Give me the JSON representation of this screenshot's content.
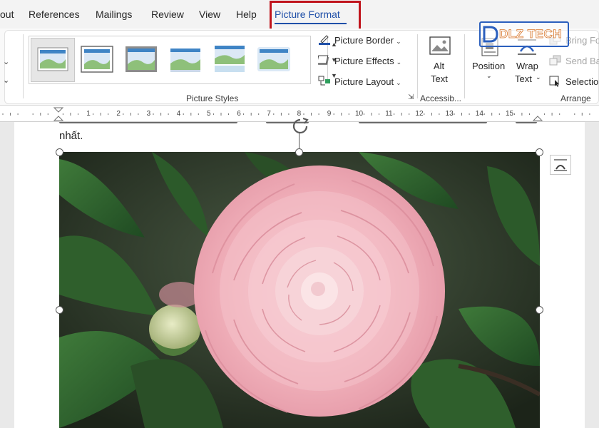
{
  "tabs": [
    {
      "label": "out"
    },
    {
      "label": "References"
    },
    {
      "label": "Mailings"
    },
    {
      "label": "Review"
    },
    {
      "label": "View"
    },
    {
      "label": "Help"
    },
    {
      "label": "Picture Format",
      "active": true
    }
  ],
  "ribbon": {
    "picture_styles": {
      "label": "Picture Styles",
      "gallery_count": 6,
      "commands": {
        "border": "Picture Border",
        "effects": "Picture Effects",
        "layout": "Picture Layout"
      }
    },
    "accessibility": {
      "label": "Accessib...",
      "alt_text_line1": "Alt",
      "alt_text_line2": "Text"
    },
    "arrange": {
      "label": "Arrange",
      "position": "Position",
      "wrap_line1": "Wrap",
      "wrap_line2": "Text",
      "bring_forward": "Bring Fo",
      "send_backward": "Send Ba",
      "selection": "Selection"
    }
  },
  "ruler": {
    "numbers": [
      "1",
      "2",
      "3",
      "4",
      "5",
      "6",
      "7",
      "8",
      "9",
      "10",
      "11",
      "12",
      "13",
      "14",
      "15"
    ]
  },
  "document": {
    "text_line": "nhất."
  },
  "watermark": {
    "brand": "DLZ TECH"
  },
  "colors": {
    "accent": "#1f4fa8",
    "highlight": "#c0141c",
    "watermark_blue": "#2b5fbd",
    "watermark_orange": "#d8762a"
  }
}
